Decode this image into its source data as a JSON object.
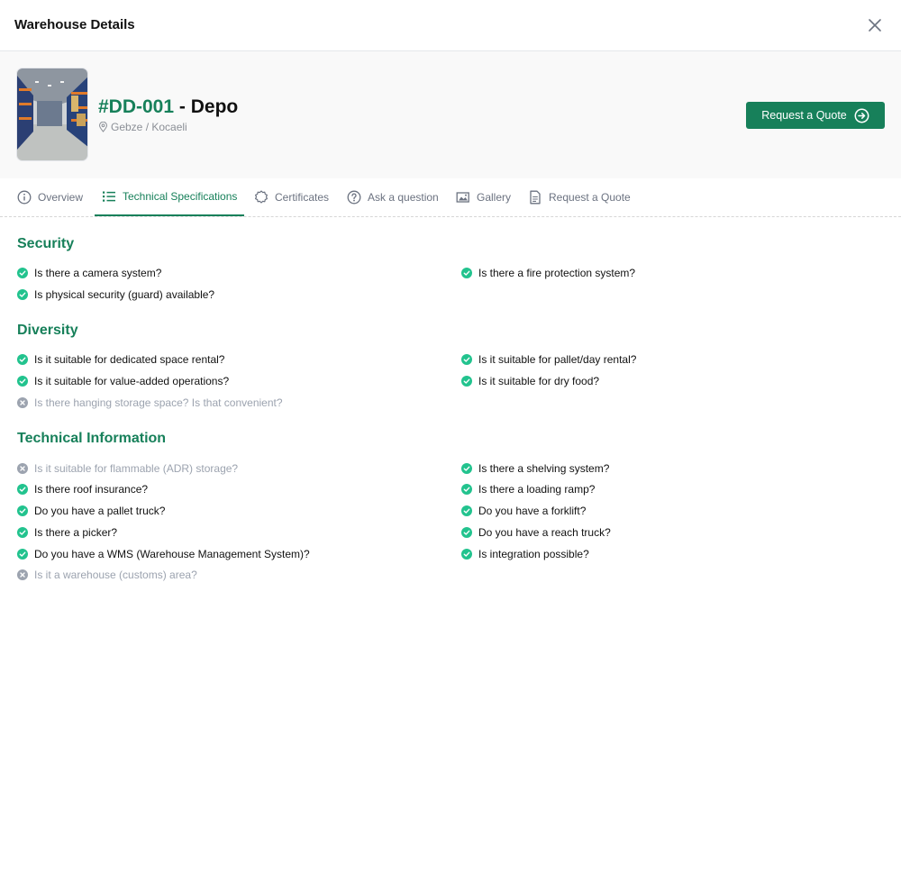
{
  "modal": {
    "title": "Warehouse Details"
  },
  "warehouse": {
    "code": "#DD-001",
    "separator": " - ",
    "name": "Depo",
    "location": "Gebze / Kocaeli",
    "quote_button": "Request a Quote"
  },
  "tabs": [
    {
      "label": "Overview",
      "icon": "info-icon",
      "active": false
    },
    {
      "label": "Technical Specifications",
      "icon": "list-icon",
      "active": true
    },
    {
      "label": "Certificates",
      "icon": "badge-icon",
      "active": false
    },
    {
      "label": "Ask a question",
      "icon": "question-icon",
      "active": false
    },
    {
      "label": "Gallery",
      "icon": "image-icon",
      "active": false
    },
    {
      "label": "Request a Quote",
      "icon": "document-icon",
      "active": false
    }
  ],
  "colors": {
    "accent": "#17805a",
    "check": "#22c38e",
    "cross": "#9ca3af"
  },
  "sections": [
    {
      "title": "Security",
      "items": [
        {
          "label": "Is there a camera system?",
          "available": true
        },
        {
          "label": "Is there a fire protection system?",
          "available": true
        },
        {
          "label": "Is physical security (guard) available?",
          "available": true
        }
      ]
    },
    {
      "title": "Diversity",
      "items": [
        {
          "label": "Is it suitable for dedicated space rental?",
          "available": true
        },
        {
          "label": "Is it suitable for pallet/day rental?",
          "available": true
        },
        {
          "label": "Is it suitable for value-added operations?",
          "available": true
        },
        {
          "label": "Is it suitable for dry food?",
          "available": true
        },
        {
          "label": "Is there hanging storage space? Is that convenient?",
          "available": false
        }
      ]
    },
    {
      "title": "Technical Information",
      "items": [
        {
          "label": "Is it suitable for flammable (ADR) storage?",
          "available": false
        },
        {
          "label": "Is there a shelving system?",
          "available": true
        },
        {
          "label": "Is there roof insurance?",
          "available": true
        },
        {
          "label": "Is there a loading ramp?",
          "available": true
        },
        {
          "label": "Do you have a pallet truck?",
          "available": true
        },
        {
          "label": "Do you have a forklift?",
          "available": true
        },
        {
          "label": "Is there a picker?",
          "available": true
        },
        {
          "label": "Do you have a reach truck?",
          "available": true
        },
        {
          "label": "Do you have a WMS (Warehouse Management System)?",
          "available": true
        },
        {
          "label": "Is integration possible?",
          "available": true
        },
        {
          "label": "Is it a warehouse (customs) area?",
          "available": false
        }
      ]
    }
  ]
}
